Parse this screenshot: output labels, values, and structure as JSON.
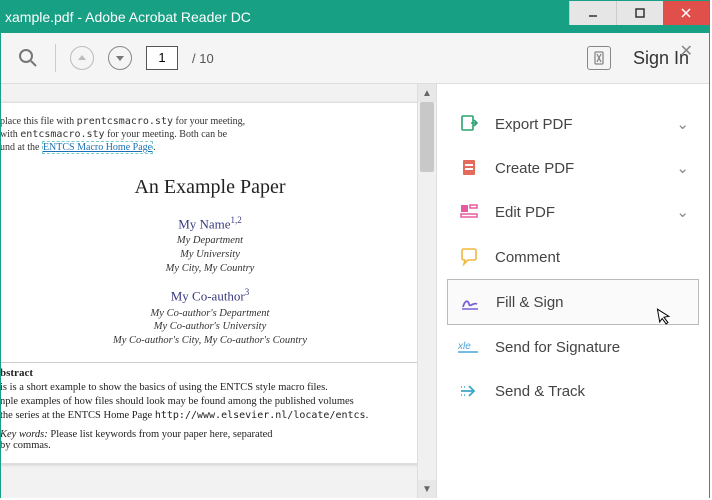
{
  "window": {
    "title": "xample.pdf - Adobe Acrobat Reader DC"
  },
  "toolbar": {
    "page_current": "1",
    "page_total": "/ 10",
    "signin": "Sign In"
  },
  "document": {
    "note_line1": "place this file with ",
    "note_tt1": "prentcsmacro.sty",
    "note_line1b": " for your meeting,",
    "note_line2": "with ",
    "note_tt2": "entcsmacro.sty",
    "note_line2b": " for your meeting. Both can be",
    "note_line3": "und at the ",
    "note_link": "ENTCS Macro Home Page",
    "title": "An Example Paper",
    "author1": "My Name",
    "author1_sup": "1,2",
    "affil1_l1": "My Department",
    "affil1_l2": "My University",
    "affil1_l3": "My City, My Country",
    "author2": "My Co-author",
    "author2_sup": "3",
    "affil2_l1": "My Co-author's Department",
    "affil2_l2": "My Co-author's University",
    "affil2_l3": "My Co-author's City, My Co-author's Country",
    "abstract_hdr": "bstract",
    "abstract_l1": "is is a short example to show the basics of using the ENTCS style macro files.",
    "abstract_l2": "nple examples of how files should look may be found among the published volumes",
    "abstract_l3a": "the series at the ENTCS Home Page ",
    "abstract_l3b": "http://www.elsevier.nl/locate/entcs",
    "abstract_l3c": ".",
    "key_label": "Key words:",
    "key_text": "  Please list keywords from your paper here, separated",
    "key_text2": "by commas."
  },
  "sidepanel": {
    "items": [
      {
        "id": "export",
        "label": "Export PDF",
        "chev": true
      },
      {
        "id": "create",
        "label": "Create PDF",
        "chev": true
      },
      {
        "id": "edit",
        "label": "Edit PDF",
        "chev": true
      },
      {
        "id": "comment",
        "label": "Comment",
        "chev": false
      },
      {
        "id": "fill",
        "label": "Fill & Sign",
        "chev": false
      },
      {
        "id": "sendforsig",
        "label": "Send for Signature",
        "chev": false
      },
      {
        "id": "sendtrack",
        "label": "Send & Track",
        "chev": false
      }
    ]
  },
  "colors": {
    "accent": "#18a085",
    "close": "#e04f4a"
  }
}
